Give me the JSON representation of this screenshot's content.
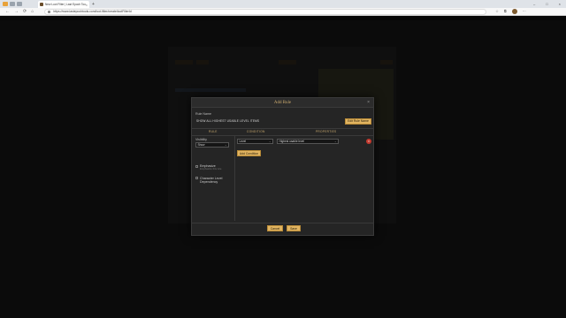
{
  "browser": {
    "tab_title": "New Loot Filter | Last Epoch Tools",
    "tab_close": "×",
    "new_tab": "+",
    "url": "https://www.lastepochtools.com/loot-filter/create/lootFilterId",
    "nav": {
      "back": "←",
      "forward": "→",
      "reload": "⟳",
      "home": "⌂"
    },
    "window_controls": {
      "minimize": "–",
      "maximize": "□",
      "close": "×"
    },
    "toolbar_icons": {
      "star": "☆",
      "extensions": "⧉",
      "menu": "⋯"
    }
  },
  "modal": {
    "title": "Add Rule",
    "close": "×",
    "rule_name_label": "Rule Name",
    "rule_name_value": "SHOW ALL HIGHEST USABLE LEVEL ITEMS",
    "edit_rule_name_button": "Edit Rule Name",
    "columns": {
      "rule": "RULE",
      "condition": "CONDITION",
      "properties": "PROPERTIES"
    },
    "visibility": {
      "label": "Visibility",
      "value": "Show",
      "chevron": "⌄"
    },
    "emphasize": {
      "label": "Emphasize",
      "sublabel": "Emphasize this rule"
    },
    "character_level_dependency": {
      "label": "Character Level Dependency"
    },
    "condition_row": {
      "condition": "Level",
      "property": "Highest usable level",
      "chevron": "⌄",
      "delete": "×"
    },
    "add_condition_button": "Add Condition",
    "cancel_button": "Cancel",
    "save_button": "Save"
  },
  "colors": {
    "accent_gold": "#e1b461",
    "title_gold": "#c9a96e",
    "danger": "#c43a2f",
    "modal_bg": "#252525"
  }
}
